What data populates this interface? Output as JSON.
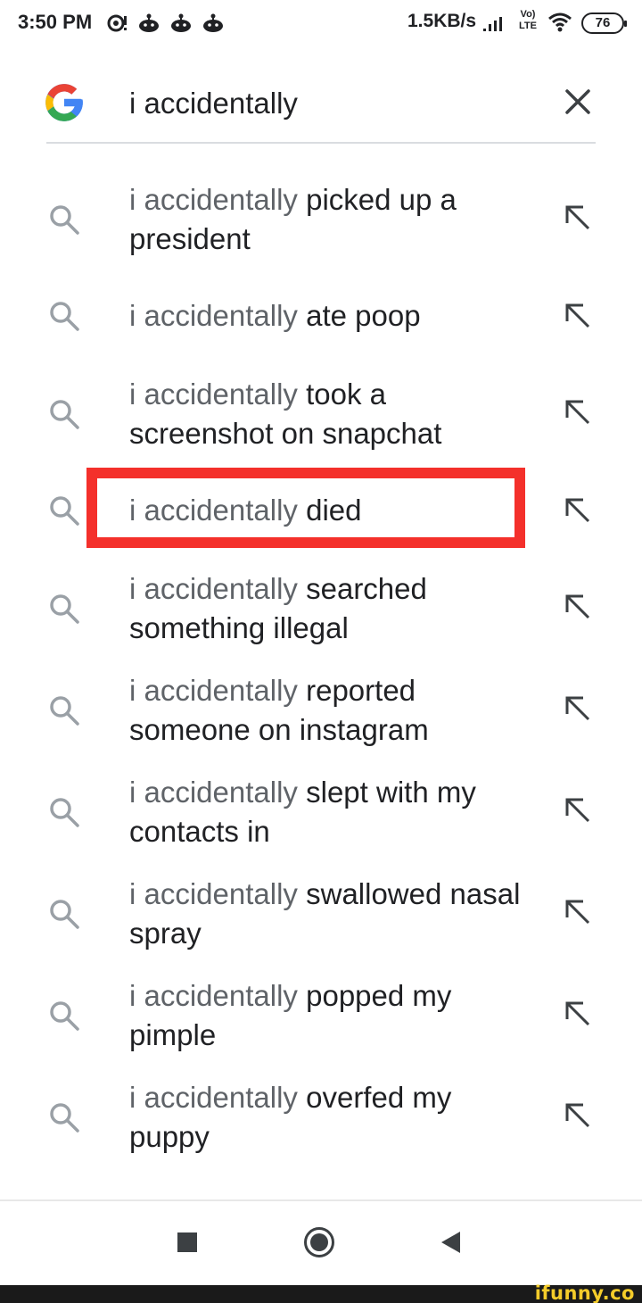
{
  "status_bar": {
    "time": "3:50 PM",
    "network_speed": "1.5KB/s",
    "lte_top": "Vo)",
    "lte_bottom": "LTE",
    "battery": "76"
  },
  "search": {
    "query": "i accidentally"
  },
  "suggestions": [
    {
      "prefix": "i accidentally",
      "suffix": "picked up a president"
    },
    {
      "prefix": "i accidentally",
      "suffix": "ate poop"
    },
    {
      "prefix": "i accidentally",
      "suffix": "took a screenshot on snapchat"
    },
    {
      "prefix": "i accidentally",
      "suffix": "died"
    },
    {
      "prefix": "i accidentally",
      "suffix": "searched something illegal"
    },
    {
      "prefix": "i accidentally",
      "suffix": "reported someone on instagram"
    },
    {
      "prefix": "i accidentally",
      "suffix": "slept with my contacts in"
    },
    {
      "prefix": "i accidentally",
      "suffix": "swallowed nasal spray"
    },
    {
      "prefix": "i accidentally",
      "suffix": "popped my pimple"
    },
    {
      "prefix": "i accidentally",
      "suffix": "overfed my puppy"
    }
  ],
  "highlight_color": "#f4302b",
  "icons": {
    "logo": "google-g-logo",
    "clear": "close-icon",
    "suggestion": "search-icon",
    "fill": "arrow-up-left-icon",
    "nav": [
      "recents-square-icon",
      "home-circle-icon",
      "back-triangle-icon"
    ]
  },
  "watermark": "ifunny.co"
}
